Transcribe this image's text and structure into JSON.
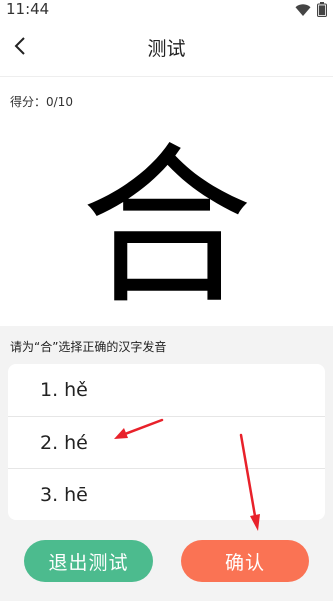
{
  "status_bar": {
    "time": "11:44",
    "icons": [
      "wifi-icon",
      "battery-icon"
    ]
  },
  "header": {
    "back_icon": "back-arrow-icon",
    "title": "测试"
  },
  "score": {
    "text": "得分：0/10"
  },
  "question": {
    "character": "合",
    "prompt": "请为“合”选择正确的汉字发音"
  },
  "options": [
    {
      "number": "1.",
      "pinyin": "hě"
    },
    {
      "number": "2.",
      "pinyin": "hé"
    },
    {
      "number": "3.",
      "pinyin": "hē"
    }
  ],
  "actions": {
    "exit_label": "退出测试",
    "confirm_label": "确认"
  },
  "colors": {
    "exit_button": "#4cbb8e",
    "confirm_button": "#fa7354",
    "annotation_arrow": "#e8212a",
    "bottom_background": "#f3f3f3"
  }
}
